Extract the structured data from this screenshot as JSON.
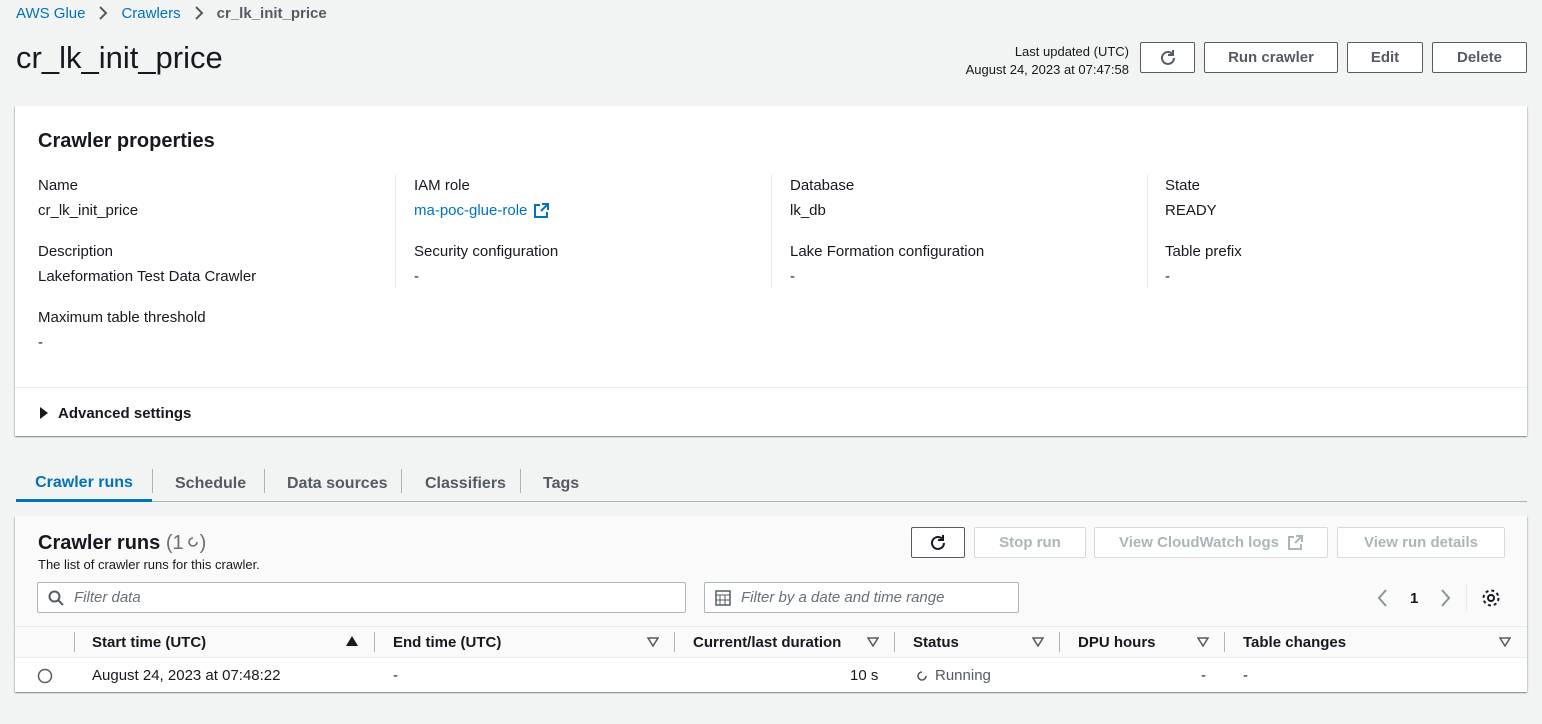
{
  "breadcrumb": {
    "items": [
      "AWS Glue",
      "Crawlers"
    ],
    "current": "cr_lk_init_price"
  },
  "page": {
    "title": "cr_lk_init_price"
  },
  "header": {
    "last_updated_label": "Last updated (UTC)",
    "last_updated_value": "August 24, 2023 at 07:47:58",
    "run_crawler": "Run crawler",
    "edit": "Edit",
    "delete": "Delete"
  },
  "properties": {
    "title": "Crawler properties",
    "name_label": "Name",
    "name_value": "cr_lk_init_price",
    "iam_label": "IAM role",
    "iam_value": "ma-poc-glue-role",
    "database_label": "Database",
    "database_value": "lk_db",
    "state_label": "State",
    "state_value": "READY",
    "description_label": "Description",
    "description_value": "Lakeformation Test Data Crawler",
    "security_label": "Security configuration",
    "security_value": "-",
    "lakeformation_label": "Lake Formation configuration",
    "lakeformation_value": "-",
    "prefix_label": "Table prefix",
    "prefix_value": "-",
    "threshold_label": "Maximum table threshold",
    "threshold_value": "-",
    "advanced": "Advanced settings"
  },
  "tabs": [
    "Crawler runs",
    "Schedule",
    "Data sources",
    "Classifiers",
    "Tags"
  ],
  "runs": {
    "title": "Crawler runs",
    "count": "(1",
    "description": "The list of crawler runs for this crawler.",
    "stop_run": "Stop run",
    "view_logs": "View CloudWatch logs",
    "view_details": "View run details",
    "filter_placeholder": "Filter data",
    "date_filter_placeholder": "Filter by a date and time range",
    "page": "1",
    "columns": [
      "Start time (UTC)",
      "End time (UTC)",
      "Current/last duration",
      "Status",
      "DPU hours",
      "Table changes"
    ],
    "rows": [
      {
        "start": "August 24, 2023 at 07:48:22",
        "end": "-",
        "duration": "10 s",
        "status": "Running",
        "dpu": "-",
        "changes": "-"
      }
    ]
  },
  "colors": {
    "link": "#0073bb",
    "text": "#16191f",
    "muted": "#545b64",
    "background": "#f2f3f3"
  }
}
